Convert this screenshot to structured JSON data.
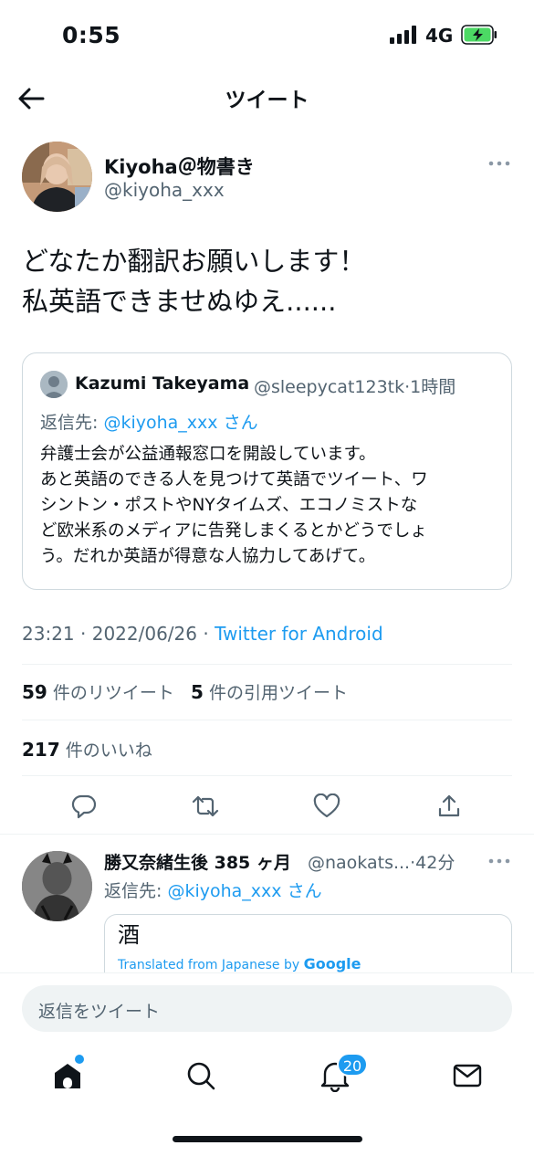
{
  "status_bar": {
    "time": "0:55",
    "network": "4G"
  },
  "header": {
    "title": "ツイート"
  },
  "tweet": {
    "author_name": "Kiyoha＠物書き",
    "author_handle": "@kiyoha_xxx",
    "text_line1": "どなたか翻訳お願いします！",
    "text_line2": "私英語できませぬゆえ......",
    "timestamp_time": "23:21",
    "timestamp_date": "2022/06/26",
    "source": "Twitter for Android",
    "retweets_count": "59",
    "retweets_label": "件のリツイート",
    "quotes_count": "5",
    "quotes_label": "件の引用ツイート",
    "likes_count": "217",
    "likes_label": "件のいいね"
  },
  "quoted_tweet": {
    "author_name": "Kazumi Takeyama",
    "author_handle": "@sleepycat123tk",
    "time": "1時間",
    "reply_prefix": "返信先: ",
    "reply_mention": "@kiyoha_xxx",
    "reply_suffix": "さん",
    "text_line1": "弁護士会が公益通報窓口を開設しています。",
    "text_line2": "あと英語のできる人を見つけて英語でツイート、ワ",
    "text_line3": "シントン・ポストやNYタイムズ、エコノミストな",
    "text_line4": "ど欧米系のメディアに告発しまくるとかどうでしょ",
    "text_line5": "う。だれか英語が得意な人協力してあげて。"
  },
  "reply_tweet": {
    "author_name": "勝又奈緒生後 385 ヶ月",
    "author_handle": "@naokats...",
    "time": "42分",
    "reply_prefix": "返信先: ",
    "reply_mention": "@kiyoha_xxx",
    "reply_suffix": "さん",
    "card_text": "酒",
    "translated_label": "Translated from Japanese by ",
    "translated_provider": "Google"
  },
  "compose": {
    "placeholder": "返信をツイート"
  },
  "bottom_nav": {
    "notifications_badge": "20"
  },
  "colors": {
    "accent": "#1d9bf0",
    "text": "#0f1419",
    "muted": "#536471",
    "border": "#cfd9de"
  },
  "icons": [
    "back-arrow-icon",
    "more-icon",
    "reply-icon",
    "retweet-icon",
    "like-icon",
    "share-icon",
    "home-icon",
    "search-icon",
    "notifications-icon",
    "messages-icon"
  ]
}
